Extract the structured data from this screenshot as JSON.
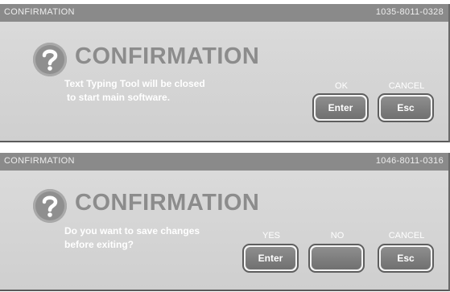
{
  "dialogs": [
    {
      "title_left": "CONFIRMATION",
      "title_right": "1035-8011-0328",
      "heading": "CONFIRMATION",
      "message_lines": [
        "Text Typing Tool will be closed",
        "to start main software."
      ],
      "buttons": [
        {
          "caption": "OK",
          "key": "Enter"
        },
        {
          "caption": "CANCEL",
          "key": "Esc"
        }
      ]
    },
    {
      "title_left": "CONFIRMATION",
      "title_right": "1046-8011-0316",
      "heading": "CONFIRMATION",
      "message_lines": [
        "Do you want to save changes",
        "before exiting?"
      ],
      "buttons": [
        {
          "caption": "YES",
          "key": "Enter"
        },
        {
          "caption": "NO",
          "key": ""
        },
        {
          "caption": "CANCEL",
          "key": "Esc"
        }
      ]
    }
  ],
  "icons": {
    "question": "question-mark-circle-icon"
  }
}
